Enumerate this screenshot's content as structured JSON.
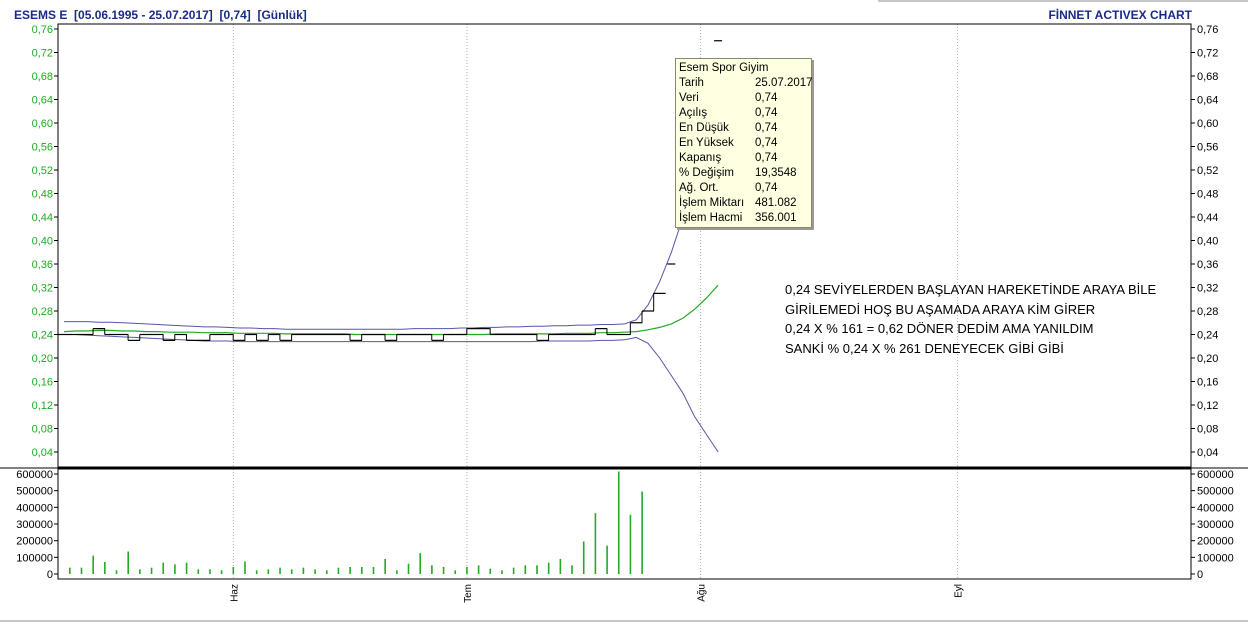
{
  "header": {
    "left": "ESEMS E  [05.06.1995 - 25.07.2017]  [0,74]  [Günlük]",
    "right": "FİNNET ACTIVEX CHART"
  },
  "colors": {
    "background": "#ffffff",
    "title_blue": "#1a2a8a",
    "price_axis_green": "#22aa22",
    "price_line": "#000000",
    "moving_average": "#22aa22",
    "bands": "#5555aa",
    "volume_bars": "#22aa22",
    "tooltip_bg": "#ffffe1"
  },
  "tooltip": {
    "title": "Esem Spor Giyim",
    "rows": [
      {
        "label": "Tarih",
        "value": "25.07.2017"
      },
      {
        "label": "Veri",
        "value": "0,74"
      },
      {
        "label": "Açılış",
        "value": "0,74"
      },
      {
        "label": "En Düşük",
        "value": "0,74"
      },
      {
        "label": "En Yüksek",
        "value": "0,74"
      },
      {
        "label": "Kapanış",
        "value": "0,74"
      },
      {
        "label": "% Değişim",
        "value": "19,3548"
      },
      {
        "label": "Ağ. Ort.",
        "value": "0,74"
      },
      {
        "label": "İşlem Miktarı",
        "value": "481.082"
      },
      {
        "label": "İşlem Hacmi",
        "value": "356.001"
      }
    ]
  },
  "annotation": {
    "lines": [
      "0,24 SEVİYELERDEN BAŞLAYAN HAREKETİNDE ARAYA BİLE",
      "GİRİLEMEDİ HOŞ BU AŞAMADA ARAYA KİM GİRER",
      "0,24 X % 161 = 0,62 DÖNER DEDİM AMA YANILDIM",
      "SANKİ % 0,24 X % 261 DENEYECEK GİBİ GİBİ"
    ]
  },
  "chart_data": [
    {
      "type": "line",
      "panel": "price",
      "ylim": [
        0.01,
        0.76
      ],
      "y_ticks": [
        "0,76",
        "0,72",
        "0,68",
        "0,64",
        "0,60",
        "0,56",
        "0,52",
        "0,48",
        "0,44",
        "0,40",
        "0,36",
        "0,32",
        "0,28",
        "0,24",
        "0,20",
        "0,16",
        "0,12",
        "0,08",
        "0,04"
      ],
      "y_tick_values": [
        0.76,
        0.72,
        0.68,
        0.64,
        0.6,
        0.56,
        0.52,
        0.48,
        0.44,
        0.4,
        0.36,
        0.32,
        0.28,
        0.24,
        0.2,
        0.16,
        0.12,
        0.08,
        0.04
      ],
      "x_ticks": [
        "Haz",
        "Tem",
        "Ağu",
        "Eyl"
      ],
      "x_tick_index": [
        14.5,
        34.5,
        54.5,
        76.5
      ],
      "x_range": [
        0,
        93.5
      ],
      "grid": "vertical",
      "series": [
        {
          "role": "price",
          "values": [
            0.24,
            0.24,
            0.24,
            0.25,
            0.24,
            0.24,
            0.23,
            0.24,
            0.24,
            0.23,
            0.24,
            0.23,
            0.23,
            0.24,
            0.24,
            0.23,
            0.24,
            0.23,
            0.24,
            0.23,
            0.24,
            0.24,
            0.24,
            0.24,
            0.24,
            0.23,
            0.24,
            0.24,
            0.23,
            0.24,
            0.24,
            0.24,
            0.23,
            0.24,
            0.24,
            0.25,
            0.25,
            0.24,
            0.24,
            0.24,
            0.24,
            0.23,
            0.24,
            0.24,
            0.24,
            0.24,
            0.25,
            0.24,
            0.24,
            0.26,
            0.28,
            0.31,
            0.36,
            0.44,
            0.52,
            0.62,
            0.74
          ]
        },
        {
          "role": "moving_average",
          "values": [
            0.245,
            0.246,
            0.246,
            0.247,
            0.247,
            0.246,
            0.246,
            0.245,
            0.245,
            0.244,
            0.244,
            0.244,
            0.243,
            0.243,
            0.243,
            0.242,
            0.242,
            0.242,
            0.242,
            0.241,
            0.241,
            0.241,
            0.241,
            0.241,
            0.241,
            0.24,
            0.24,
            0.24,
            0.24,
            0.24,
            0.24,
            0.24,
            0.24,
            0.24,
            0.24,
            0.24,
            0.24,
            0.241,
            0.241,
            0.241,
            0.241,
            0.241,
            0.241,
            0.242,
            0.242,
            0.242,
            0.243,
            0.243,
            0.244,
            0.245,
            0.248,
            0.252,
            0.258,
            0.268,
            0.283,
            0.302,
            0.324
          ]
        },
        {
          "role": "upper_band",
          "values": [
            0.262,
            0.262,
            0.262,
            0.261,
            0.261,
            0.26,
            0.259,
            0.258,
            0.257,
            0.256,
            0.255,
            0.254,
            0.253,
            0.253,
            0.252,
            0.251,
            0.251,
            0.25,
            0.25,
            0.249,
            0.249,
            0.249,
            0.249,
            0.249,
            0.249,
            0.249,
            0.249,
            0.249,
            0.249,
            0.249,
            0.25,
            0.25,
            0.25,
            0.25,
            0.251,
            0.251,
            0.252,
            0.252,
            0.253,
            0.253,
            0.254,
            0.254,
            0.255,
            0.255,
            0.256,
            0.256,
            0.257,
            0.257,
            0.258,
            0.265,
            0.29,
            0.33,
            0.38,
            0.44,
            0.5,
            0.55,
            0.61
          ]
        },
        {
          "role": "lower_band",
          "values": [
            0.24,
            0.24,
            0.239,
            0.238,
            0.237,
            0.236,
            0.235,
            0.234,
            0.233,
            0.232,
            0.231,
            0.23,
            0.229,
            0.229,
            0.229,
            0.228,
            0.228,
            0.228,
            0.228,
            0.228,
            0.228,
            0.228,
            0.228,
            0.228,
            0.228,
            0.228,
            0.228,
            0.228,
            0.228,
            0.228,
            0.228,
            0.228,
            0.228,
            0.228,
            0.228,
            0.228,
            0.228,
            0.228,
            0.228,
            0.228,
            0.228,
            0.229,
            0.229,
            0.229,
            0.229,
            0.229,
            0.23,
            0.23,
            0.231,
            0.235,
            0.225,
            0.2,
            0.17,
            0.14,
            0.1,
            0.07,
            0.04
          ]
        }
      ]
    },
    {
      "type": "bar",
      "panel": "volume",
      "ylim": [
        0,
        625000
      ],
      "y_ticks": [
        "600000",
        "500000",
        "400000",
        "300000",
        "200000",
        "100000",
        "0"
      ],
      "y_tick_values": [
        600000,
        500000,
        400000,
        300000,
        200000,
        100000,
        0
      ],
      "values": [
        38000,
        38000,
        110000,
        72000,
        22000,
        135000,
        28000,
        38000,
        68000,
        58000,
        68000,
        28000,
        28000,
        22000,
        42000,
        75000,
        22000,
        28000,
        38000,
        28000,
        38000,
        28000,
        22000,
        38000,
        42000,
        42000,
        42000,
        90000,
        22000,
        62000,
        125000,
        52000,
        42000,
        22000,
        42000,
        52000,
        32000,
        22000,
        38000,
        52000,
        52000,
        68000,
        90000,
        52000,
        195000,
        365000,
        170000,
        615000,
        355000,
        495000
      ]
    }
  ]
}
